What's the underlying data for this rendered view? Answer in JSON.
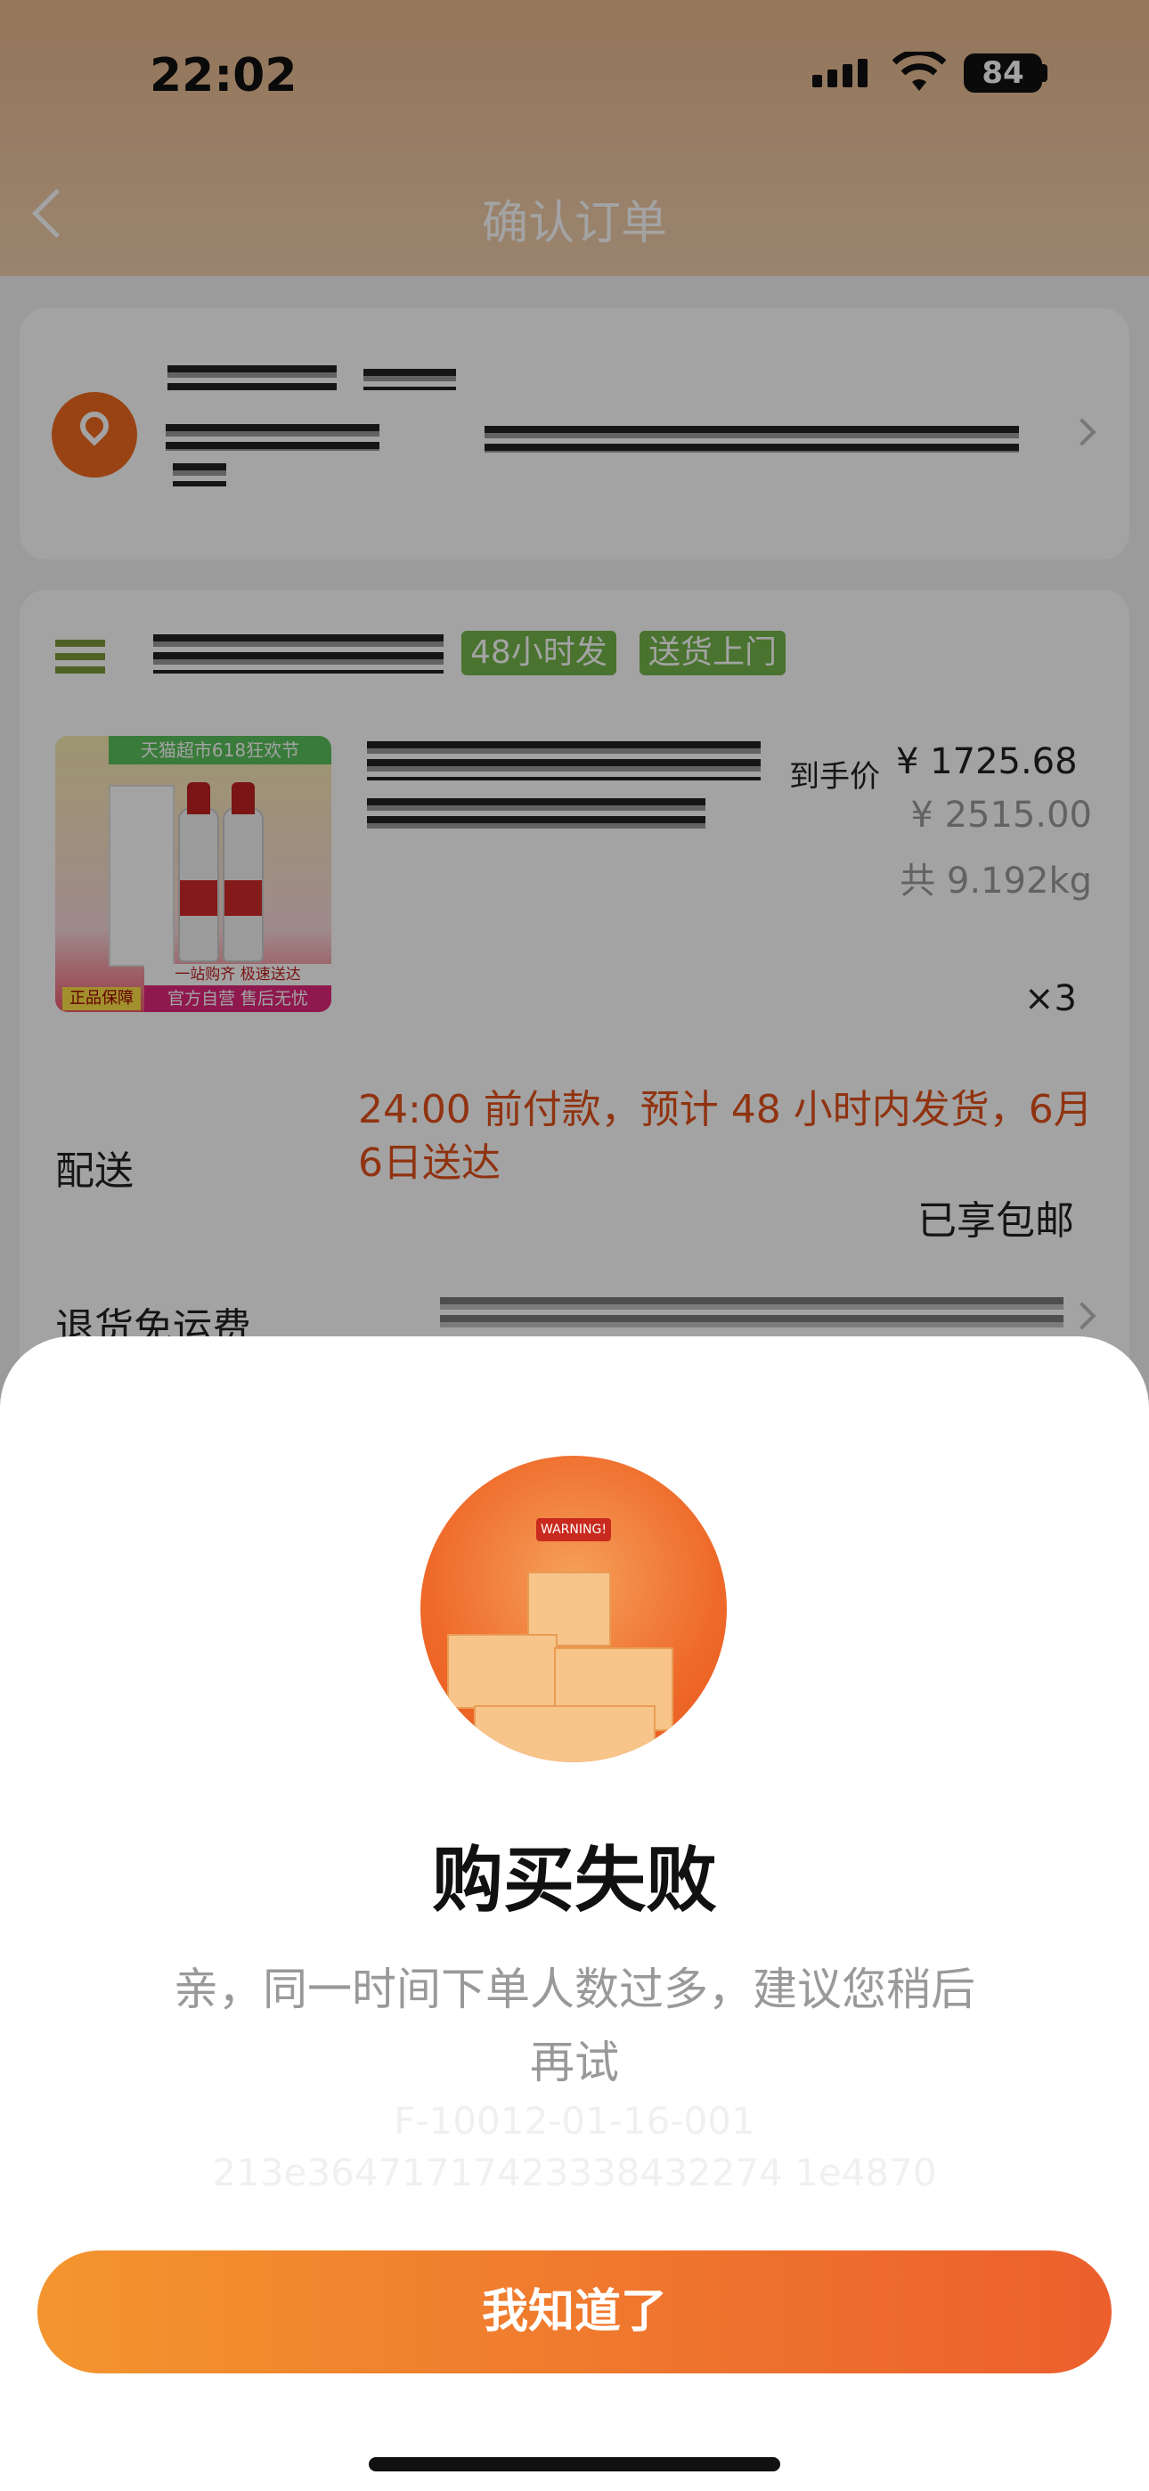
{
  "status_bar": {
    "time": "22:02",
    "battery": "84"
  },
  "header": {
    "title": "确认订单"
  },
  "order": {
    "tags": [
      "48小时发",
      "送货上门"
    ],
    "product": {
      "promo_top": "天猫超市618狂欢节",
      "promo_mid": "一站购齐 极速送达",
      "promo_bottom": "官方自营 售后无忧",
      "promo_badge": "正品保障",
      "price_label": "到手价",
      "price": "¥ 1725.68",
      "original_price": "¥ 2515.00",
      "weight": "共 9.192kg",
      "quantity": "×3"
    },
    "delivery_label": "配送",
    "delivery_note": "24:00 前付款，预计 48 小时内发货，6月6日送达",
    "free_shipping": "已享包邮",
    "return_label": "退货免运费"
  },
  "dialog": {
    "title": "购买失败",
    "message": "亲，同一时间下单人数过多，建议您稍后再试",
    "code_line1": "F-10012-01-16-001",
    "code_line2": "213e36471717423338432274 1e4870",
    "button": "我知道了",
    "illustration_text": "WARNING!"
  },
  "colors": {
    "accent": "#ec5f2d",
    "header": "#e8b98d",
    "tag": "#73b54a"
  }
}
